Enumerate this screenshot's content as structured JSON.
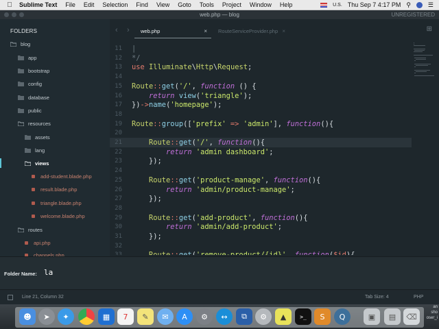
{
  "menubar": {
    "apple": "",
    "app_name": "Sublime Text",
    "items": [
      "File",
      "Edit",
      "Selection",
      "Find",
      "View",
      "Goto",
      "Tools",
      "Project",
      "Window",
      "Help"
    ],
    "input_source": "U.S.",
    "clock": "Thu Sep 7  4:17 PM"
  },
  "window": {
    "title": "web.php — blog",
    "license": "UNREGISTERED"
  },
  "sidebar": {
    "heading": "FOLDERS",
    "items": [
      {
        "label": "blog"
      },
      {
        "label": "app"
      },
      {
        "label": "bootstrap"
      },
      {
        "label": "config"
      },
      {
        "label": "database"
      },
      {
        "label": "public"
      },
      {
        "label": "resources"
      },
      {
        "label": "assets"
      },
      {
        "label": "lang"
      },
      {
        "label": "views"
      },
      {
        "label": "add-student.blade.php"
      },
      {
        "label": "result.blade.php"
      },
      {
        "label": "triangle.blade.php"
      },
      {
        "label": "welcome.blade.php"
      },
      {
        "label": "routes"
      },
      {
        "label": "api.php"
      },
      {
        "label": "channels.php"
      }
    ]
  },
  "tabs": [
    {
      "label": "web.php",
      "close": "×"
    },
    {
      "label": "RouteServiceProvider.php",
      "close": "×"
    }
  ],
  "editor": {
    "lines": [
      {
        "n": "11",
        "text": "|"
      },
      {
        "n": "12",
        "text": "*/"
      },
      {
        "n": "13",
        "text": "use Illuminate\\Http\\Request;"
      },
      {
        "n": "14",
        "text": ""
      },
      {
        "n": "15",
        "text": "Route::get('/', function () {"
      },
      {
        "n": "16",
        "text": "    return view('triangle');"
      },
      {
        "n": "17",
        "text": "})->name('homepage');"
      },
      {
        "n": "18",
        "text": ""
      },
      {
        "n": "19",
        "text": "Route::group(['prefix' => 'admin'], function(){"
      },
      {
        "n": "20",
        "text": ""
      },
      {
        "n": "21",
        "text": "    Route::get('/', function(){"
      },
      {
        "n": "22",
        "text": "        return 'admin dashboard';"
      },
      {
        "n": "23",
        "text": "    });"
      },
      {
        "n": "24",
        "text": ""
      },
      {
        "n": "25",
        "text": "    Route::get('product-manage', function(){"
      },
      {
        "n": "26",
        "text": "        return 'admin/product-manage';"
      },
      {
        "n": "27",
        "text": "    });"
      },
      {
        "n": "28",
        "text": ""
      },
      {
        "n": "29",
        "text": "    Route::get('add-product', function(){"
      },
      {
        "n": "30",
        "text": "        return 'admin/add-product';"
      },
      {
        "n": "31",
        "text": "    });"
      },
      {
        "n": "32",
        "text": ""
      },
      {
        "n": "33",
        "text": "    Route::get('remove-product/{id}', function($id){"
      }
    ]
  },
  "input_panel": {
    "label": "Folder Name:",
    "value": "la"
  },
  "statusbar": {
    "position": "Line 21, Column 32",
    "tab_size": "Tab Size: 4",
    "syntax": "PHP"
  },
  "dock": {
    "side_text": "an\nsho\noser_i"
  },
  "colors": {
    "background": "#1e272c",
    "sidebar": "#202b31",
    "accent": "#5ec5d6"
  }
}
